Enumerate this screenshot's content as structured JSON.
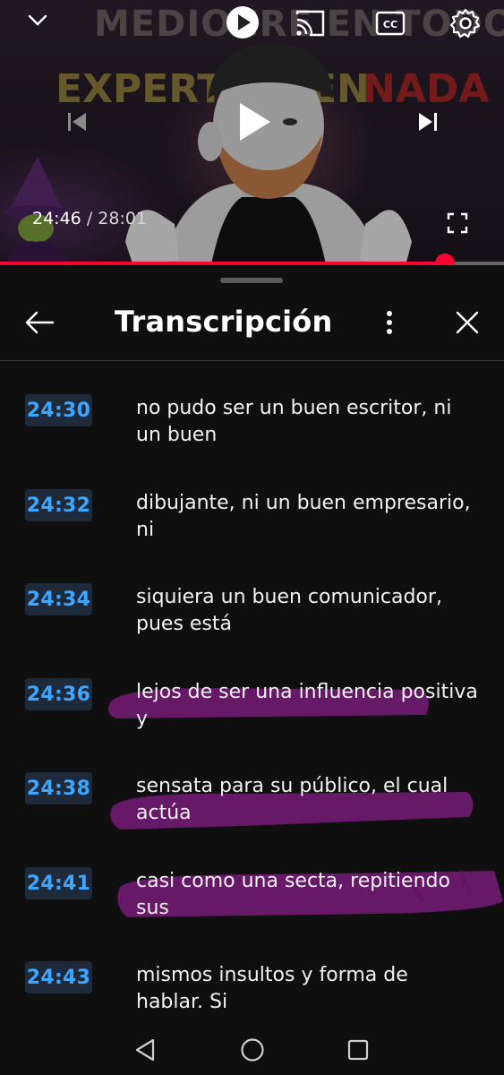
{
  "video": {
    "thumbnail_text_line1": "MEDIOCRE EN TODO",
    "thumbnail_text_word1": "EXPERTO",
    "thumbnail_text_word2": "EN",
    "thumbnail_text_word3": "NADA",
    "current_time": "24:46",
    "separator": "/",
    "duration": "28:01",
    "progress": 0.883,
    "controls": [
      "collapse-icon",
      "autoplay-toggle-icon",
      "cast-icon",
      "captions-icon",
      "settings-icon",
      "previous-icon",
      "play-icon",
      "next-icon",
      "fullscreen-icon"
    ]
  },
  "transcript": {
    "title": "Transcripción",
    "back_icon": "arrow-left-icon",
    "menu_icon": "more-vertical-icon",
    "close_icon": "close-icon",
    "segments": [
      {
        "time": "24:30",
        "text": "no pudo ser un buen escritor, ni un buen",
        "highlighted": false
      },
      {
        "time": "24:32",
        "text": "dibujante, ni un buen empresario, ni",
        "highlighted": false
      },
      {
        "time": "24:34",
        "text": "siquiera un buen comunicador, pues está",
        "highlighted": false
      },
      {
        "time": "24:36",
        "text": "lejos de ser una influencia positiva y",
        "highlighted": true
      },
      {
        "time": "24:38",
        "text": "sensata para su público, el cual actúa",
        "highlighted": true
      },
      {
        "time": "24:41",
        "text": "casi como una secta, repitiendo sus",
        "highlighted": true
      },
      {
        "time": "24:43",
        "text": "mismos insultos y forma de hablar. Si",
        "highlighted": false
      }
    ],
    "highlight_color": "#8a1a8a"
  },
  "navbar": {
    "items": [
      "back-triangle-icon",
      "home-circle-icon",
      "recents-square-icon"
    ]
  },
  "colors": {
    "background": "#0f0f0f",
    "accent_red": "#ff0033",
    "timestamp_blue": "#3ea6ff",
    "timestamp_bg": "#1e2a3a"
  }
}
